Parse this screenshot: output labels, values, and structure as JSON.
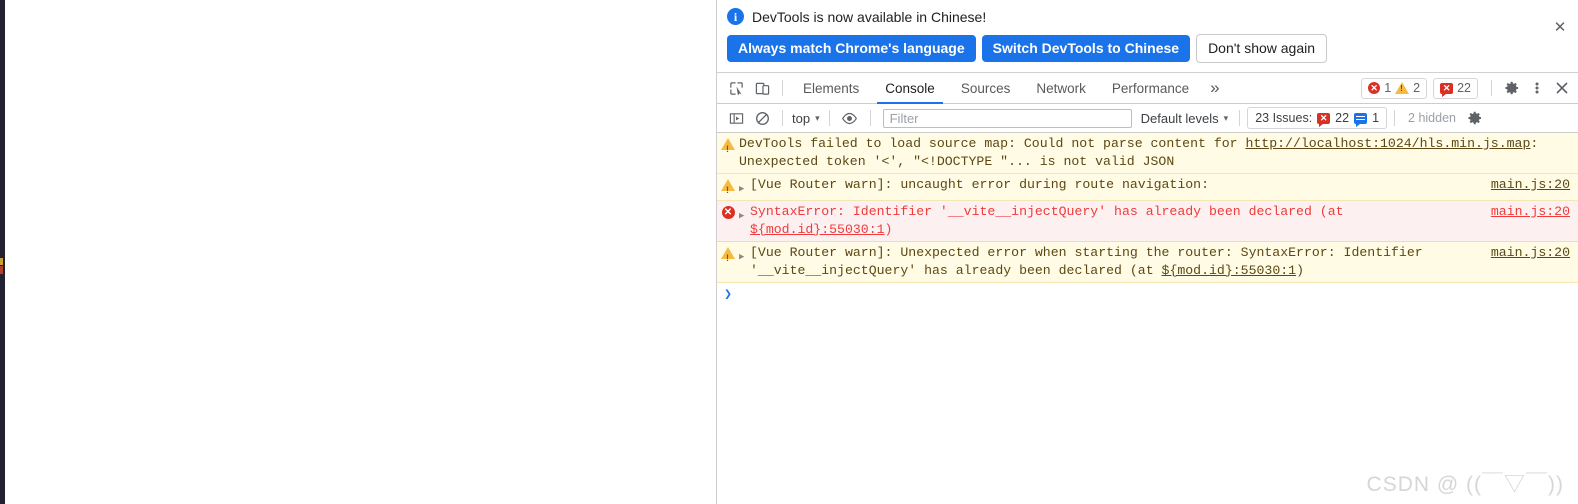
{
  "banner": {
    "icon": "info-icon",
    "message": "DevTools is now available in Chinese!",
    "buttons": {
      "always_match": "Always match Chrome's language",
      "switch": "Switch DevTools to Chinese",
      "dont_show": "Don't show again"
    },
    "close": "✕"
  },
  "toolbar": {
    "inspect_icon": "inspect-element-icon",
    "device_icon": "device-toolbar-icon",
    "tabs": [
      {
        "label": "Elements",
        "active": false
      },
      {
        "label": "Console",
        "active": true
      },
      {
        "label": "Sources",
        "active": false
      },
      {
        "label": "Network",
        "active": false
      },
      {
        "label": "Performance",
        "active": false
      }
    ],
    "more_tabs": "»",
    "error_count": "1",
    "warning_count": "2",
    "issue_count": "22",
    "error_glyph": "✕",
    "issue_glyph": "✕",
    "settings_icon": "gear-icon",
    "menu_icon": "kebab-menu-icon",
    "close_icon": "close-icon"
  },
  "filterbar": {
    "sidebar_icon": "console-sidebar-icon",
    "clear_icon": "clear-console-icon",
    "context": "top",
    "caret": "▾",
    "eye_icon": "live-expression-icon",
    "filter_placeholder": "Filter",
    "filter_value": "",
    "levels": "Default levels",
    "issues_label": "23 Issues:",
    "issues_errors": "22",
    "issues_infos": "1",
    "hidden_label": "2 hidden",
    "settings_icon": "console-settings-gear-icon"
  },
  "console": {
    "messages": [
      {
        "kind": "warn",
        "icon": "warning-triangle-icon",
        "expandable": false,
        "text_before": "DevTools failed to load source map: Could not parse content for ",
        "link": "http://localhost:1024/hls.min.js.map",
        "text_after": ": Unexpected token '<', \"<!DOCTYPE \"... is not valid JSON",
        "source": ""
      },
      {
        "kind": "warn",
        "icon": "warning-triangle-icon",
        "expandable": true,
        "text_before": "[Vue Router warn]: uncaught error during route navigation:",
        "link": "",
        "text_after": "",
        "source": "main.js:20"
      },
      {
        "kind": "err",
        "icon": "error-circle-icon",
        "expandable": true,
        "text_before": "SyntaxError: Identifier '__vite__injectQuery' has already been declared (at ",
        "link": "${mod.id}:55030:1",
        "text_after": ")",
        "source": "main.js:20"
      },
      {
        "kind": "warn",
        "icon": "warning-triangle-icon",
        "expandable": true,
        "text_before": "[Vue Router warn]: Unexpected error when starting the router: SyntaxError: Identifier '__vite__injectQuery' has already been declared (at ",
        "link": "${mod.id}:55030:1",
        "text_after": ")",
        "source": "main.js:20"
      }
    ],
    "prompt_caret": "❯"
  },
  "watermark": "CSDN @ ((￣▽￣))",
  "colors": {
    "accent_blue": "#1a73e8",
    "error_red": "#d93025",
    "warning_yellow": "#f5bb41",
    "warn_bg": "#fffbe5",
    "error_bg": "#fdf0f0"
  }
}
